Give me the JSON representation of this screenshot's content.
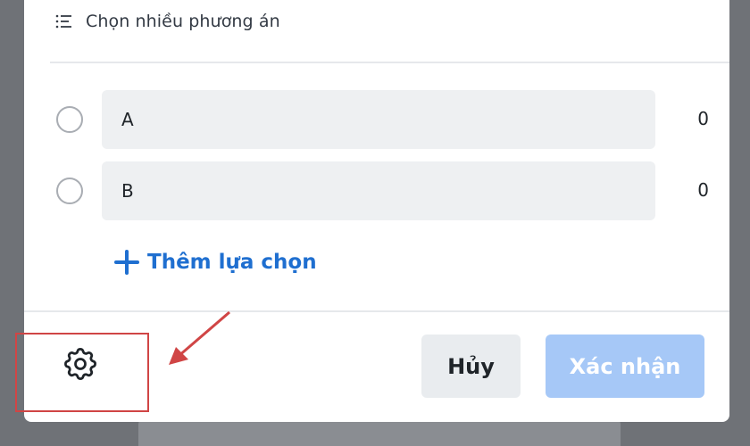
{
  "poll": {
    "mode_label": "Chọn nhiều phương án",
    "mode_icon": "list-icon",
    "options": [
      {
        "label": "A",
        "count": "0"
      },
      {
        "label": "B",
        "count": "0"
      }
    ],
    "add_choice_label": "Thêm lựa chọn",
    "add_choice_icon": "plus-icon"
  },
  "footer": {
    "settings_icon": "gear-icon",
    "cancel_label": "Hủy",
    "confirm_label": "Xác nhận"
  },
  "colors": {
    "accent": "#1f6fd0",
    "confirm_disabled": "#a6c8f7",
    "annotation": "#d04545"
  }
}
